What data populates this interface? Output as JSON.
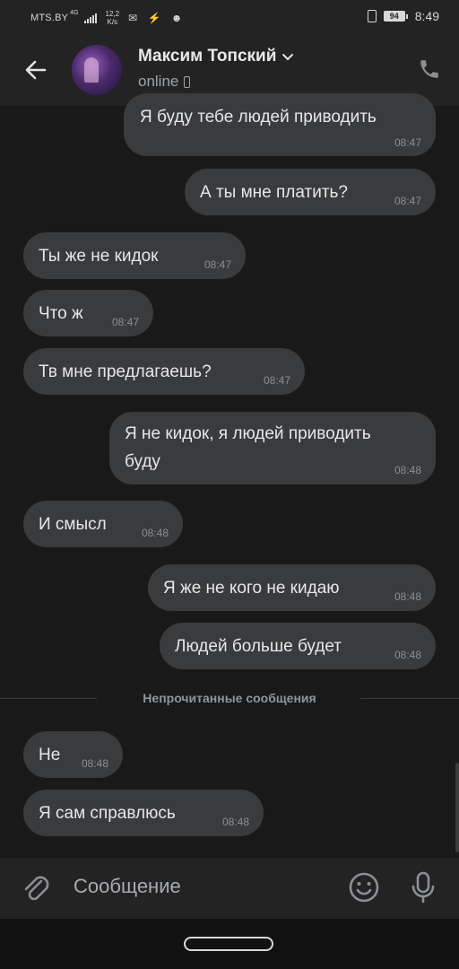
{
  "status_bar": {
    "carrier": "MTS.BY",
    "network": "4G",
    "speed_value": "12,2",
    "speed_unit": "K/s",
    "battery": "94",
    "time": "8:49"
  },
  "header": {
    "back_icon": "arrow-left-icon",
    "contact_name": "Максим Топский",
    "presence": "online",
    "call_icon": "phone-icon"
  },
  "messages": [
    {
      "side": "out",
      "text": "Я буду тебе людей приводить",
      "time": "08:47"
    },
    {
      "side": "out",
      "text": "А ты мне платить?",
      "time": "08:47"
    },
    {
      "side": "in",
      "text": "Ты же не кидок",
      "time": "08:47"
    },
    {
      "side": "in",
      "text": "Что ж",
      "time": "08:47"
    },
    {
      "side": "in",
      "text": "Тв мне предлагаешь?",
      "time": "08:47"
    },
    {
      "side": "out",
      "text_line1": "Я не кидок, я людей приводить",
      "text_line2": "буду",
      "time": "08:48"
    },
    {
      "side": "in",
      "text": "И смысл",
      "time": "08:48"
    },
    {
      "side": "out",
      "text": "Я же не кого не кидаю",
      "time": "08:48"
    },
    {
      "side": "out",
      "text": "Людей больше будет",
      "time": "08:48"
    },
    {
      "side": "in",
      "text": "Не",
      "time": "08:48"
    },
    {
      "side": "in",
      "text": "Я сам справлюсь",
      "time": "08:48"
    }
  ],
  "unread_divider": "Непрочитанные сообщения",
  "composer": {
    "placeholder": "Сообщение",
    "attach_icon": "paperclip-icon",
    "emoji_icon": "emoji-icon",
    "mic_icon": "microphone-icon"
  },
  "colors": {
    "background": "#19191a",
    "bar": "#232324",
    "bubble": "#3a3b3c",
    "text": "#e6e7e9",
    "muted": "#8b8f94"
  }
}
